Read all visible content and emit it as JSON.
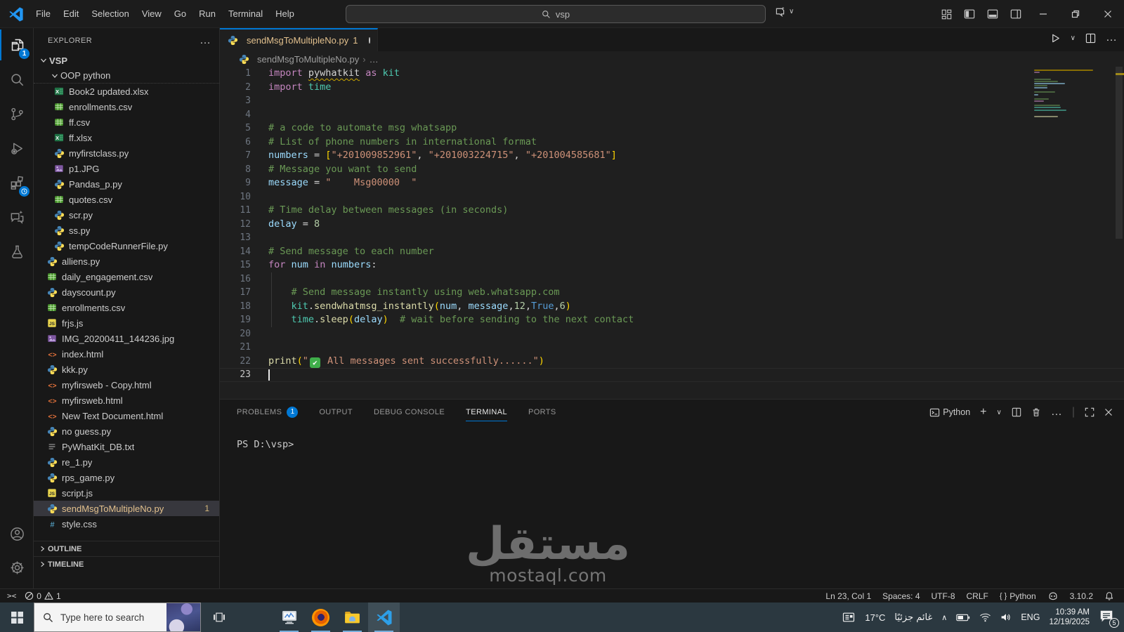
{
  "titlebar": {
    "menus": [
      "File",
      "Edit",
      "Selection",
      "View",
      "Go",
      "Run",
      "Terminal",
      "Help"
    ],
    "search_value": "vsp"
  },
  "icons": {
    "back": "←",
    "forward": "→",
    "more": "…",
    "chevron_down": "∨",
    "plus": "+",
    "tray_chevron": "∧",
    "breadcrumb_sep": "›",
    "divider": "|"
  },
  "activity_bar": {
    "items": [
      {
        "name": "explorer",
        "active": true,
        "badge": "1"
      },
      {
        "name": "search"
      },
      {
        "name": "source-control"
      },
      {
        "name": "run-debug"
      },
      {
        "name": "extensions",
        "badge_clock": true
      },
      {
        "name": "chat"
      },
      {
        "name": "testing"
      }
    ],
    "bottom": [
      {
        "name": "account"
      },
      {
        "name": "settings"
      }
    ]
  },
  "explorer": {
    "title": "EXPLORER",
    "root_folder": "VSP",
    "sub_folder": "OOP python",
    "outline": "OUTLINE",
    "timeline": "TIMELINE",
    "files": [
      {
        "name": "Book2  updated.xlsx",
        "icon": "excel",
        "level": 2
      },
      {
        "name": "enrollments.csv",
        "icon": "csv",
        "level": 2
      },
      {
        "name": "ff.csv",
        "icon": "csv",
        "level": 2
      },
      {
        "name": "ff.xlsx",
        "icon": "excel",
        "level": 2
      },
      {
        "name": "myfirstclass.py",
        "icon": "python",
        "level": 2
      },
      {
        "name": "p1.JPG",
        "icon": "image",
        "level": 2
      },
      {
        "name": "Pandas_p.py",
        "icon": "python",
        "level": 2
      },
      {
        "name": "quotes.csv",
        "icon": "csv",
        "level": 2
      },
      {
        "name": "scr.py",
        "icon": "python",
        "level": 2
      },
      {
        "name": "ss.py",
        "icon": "python",
        "level": 2
      },
      {
        "name": "tempCodeRunnerFile.py",
        "icon": "python",
        "level": 2
      },
      {
        "name": "alliens.py",
        "icon": "python",
        "level": 1
      },
      {
        "name": "daily_engagement.csv",
        "icon": "csv",
        "level": 1
      },
      {
        "name": "dayscount.py",
        "icon": "python",
        "level": 1
      },
      {
        "name": "enrollments.csv",
        "icon": "csv",
        "level": 1
      },
      {
        "name": "frjs.js",
        "icon": "js",
        "level": 1
      },
      {
        "name": "IMG_20200411_144236.jpg",
        "icon": "image",
        "level": 1
      },
      {
        "name": "index.html",
        "icon": "html",
        "level": 1
      },
      {
        "name": "kkk.py",
        "icon": "python",
        "level": 1
      },
      {
        "name": "myfirsweb - Copy.html",
        "icon": "html",
        "level": 1
      },
      {
        "name": "myfirsweb.html",
        "icon": "html",
        "level": 1
      },
      {
        "name": "New Text Document.html",
        "icon": "html",
        "level": 1
      },
      {
        "name": "no guess.py",
        "icon": "python",
        "level": 1
      },
      {
        "name": "PyWhatKit_DB.txt",
        "icon": "txt",
        "level": 1
      },
      {
        "name": "re_1.py",
        "icon": "python",
        "level": 1
      },
      {
        "name": "rps_game.py",
        "icon": "python",
        "level": 1
      },
      {
        "name": "script.js",
        "icon": "js",
        "level": 1
      },
      {
        "name": "sendMsgToMultipleNo.py",
        "icon": "python",
        "level": 1,
        "selected": true,
        "modified": true,
        "badge": "1"
      },
      {
        "name": "style.css",
        "icon": "css",
        "level": 1
      }
    ]
  },
  "editor": {
    "tab": {
      "label": "sendMsgToMultipleNo.py",
      "badge": "1"
    },
    "breadcrumb": {
      "file": "sendMsgToMultipleNo.py",
      "more": "…"
    },
    "lines": [
      {
        "s": [
          [
            "import",
            "kw"
          ],
          [
            " ",
            "pln"
          ],
          [
            "pywhatkit",
            "sqg"
          ],
          [
            " ",
            "pln"
          ],
          [
            "as",
            "kw"
          ],
          [
            " ",
            "pln"
          ],
          [
            "kit",
            "typ"
          ]
        ]
      },
      {
        "s": [
          [
            "import",
            "kw"
          ],
          [
            " ",
            "pln"
          ],
          [
            "time",
            "typ"
          ]
        ]
      },
      {
        "s": []
      },
      {
        "s": []
      },
      {
        "s": [
          [
            "# a code to automate msg whatsapp",
            "cmt"
          ]
        ]
      },
      {
        "s": [
          [
            "# List of phone numbers in international format",
            "cmt"
          ]
        ]
      },
      {
        "s": [
          [
            "numbers",
            "var"
          ],
          [
            " = ",
            "pln"
          ],
          [
            "[",
            "brk"
          ],
          [
            "\"+201009852961\"",
            "str"
          ],
          [
            ", ",
            "pln"
          ],
          [
            "\"+201003224715\"",
            "str"
          ],
          [
            ", ",
            "pln"
          ],
          [
            "\"+201004585681\"",
            "str"
          ],
          [
            "]",
            "brk"
          ]
        ]
      },
      {
        "s": [
          [
            "# Message you want to send",
            "cmt"
          ]
        ]
      },
      {
        "s": [
          [
            "message",
            "var"
          ],
          [
            " = ",
            "pln"
          ],
          [
            "\"    Msg00000  \"",
            "str"
          ]
        ]
      },
      {
        "s": []
      },
      {
        "s": [
          [
            "# Time delay between messages (in seconds)",
            "cmt"
          ]
        ]
      },
      {
        "s": [
          [
            "delay",
            "var"
          ],
          [
            " = ",
            "pln"
          ],
          [
            "8",
            "num"
          ]
        ]
      },
      {
        "s": []
      },
      {
        "s": [
          [
            "# Send message to each number",
            "cmt"
          ]
        ]
      },
      {
        "s": [
          [
            "for",
            "kw"
          ],
          [
            " ",
            "pln"
          ],
          [
            "num",
            "var"
          ],
          [
            " ",
            "pln"
          ],
          [
            "in",
            "kw"
          ],
          [
            " ",
            "pln"
          ],
          [
            "numbers",
            "var"
          ],
          [
            ":",
            "pln"
          ]
        ]
      },
      {
        "s": [],
        "g": true
      },
      {
        "s": [
          [
            "    ",
            "pln"
          ],
          [
            "# Send message instantly using web.whatsapp.com",
            "cmt"
          ]
        ],
        "g": true
      },
      {
        "s": [
          [
            "    ",
            "pln"
          ],
          [
            "kit",
            "typ"
          ],
          [
            ".",
            "pln"
          ],
          [
            "sendwhatmsg_instantly",
            "fn"
          ],
          [
            "(",
            "brk"
          ],
          [
            "num",
            "var"
          ],
          [
            ", ",
            "pln"
          ],
          [
            "message",
            "var"
          ],
          [
            ",",
            "pln"
          ],
          [
            "12",
            "num"
          ],
          [
            ",",
            "pln"
          ],
          [
            "True",
            "bool"
          ],
          [
            ",",
            "pln"
          ],
          [
            "6",
            "num"
          ],
          [
            ")",
            "brk"
          ]
        ],
        "g": true
      },
      {
        "s": [
          [
            "    ",
            "pln"
          ],
          [
            "time",
            "typ"
          ],
          [
            ".",
            "pln"
          ],
          [
            "sleep",
            "fn"
          ],
          [
            "(",
            "brk"
          ],
          [
            "delay",
            "var"
          ],
          [
            ")",
            "brk"
          ],
          [
            "  ",
            "pln"
          ],
          [
            "# wait before sending to the next contact",
            "cmt"
          ]
        ],
        "g": true
      },
      {
        "s": []
      },
      {
        "s": []
      },
      {
        "s": [
          [
            "print",
            "fn"
          ],
          [
            "(",
            "brk"
          ],
          [
            "\"",
            "str"
          ],
          [
            "✔",
            "emoji"
          ],
          [
            " All messages sent successfully......\"",
            "str"
          ],
          [
            ")",
            "brk"
          ]
        ]
      },
      {
        "s": [],
        "cursor": true
      }
    ]
  },
  "panel": {
    "tabs": [
      {
        "label": "PROBLEMS",
        "name": "problems",
        "badge": "1"
      },
      {
        "label": "OUTPUT",
        "name": "output"
      },
      {
        "label": "DEBUG CONSOLE",
        "name": "debug-console"
      },
      {
        "label": "TERMINAL",
        "name": "terminal",
        "active": true
      },
      {
        "label": "PORTS",
        "name": "ports"
      }
    ],
    "terminal_profile": "Python",
    "terminal_prompt": "PS D:\\vsp>"
  },
  "status_bar": {
    "errors": "0",
    "warnings": "1",
    "cursor": "Ln 23, Col 1",
    "indent": "Spaces: 4",
    "encoding": "UTF-8",
    "eol": "CRLF",
    "language_glyph": "{ }",
    "language": "Python",
    "python_version": "3.10.2"
  },
  "taskbar": {
    "search_placeholder": "Type here to search",
    "tray": {
      "temperature": "17°C",
      "weather": "غائم جزئيًا",
      "language": "ENG",
      "time": "10:39 AM",
      "date": "12/19/2025",
      "notification_count": "5"
    }
  },
  "watermark": {
    "arabic": "مستقل",
    "latin": "mostaql.com"
  }
}
